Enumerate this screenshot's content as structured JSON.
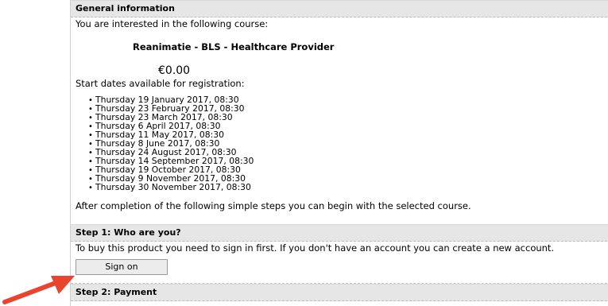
{
  "general": {
    "header": "General information",
    "intro": "You are interested in the following course:",
    "course_name": "Reanimatie - BLS - Healthcare Provider",
    "price": "€0.00",
    "dates_label": "Start dates available for registration:",
    "dates": [
      "Thursday 19 January 2017, 08:30",
      "Thursday 23 February 2017, 08:30",
      "Thursday 23 March 2017, 08:30",
      "Thursday 6 April 2017, 08:30",
      "Thursday 11 May 2017, 08:30",
      "Thursday 8 June 2017, 08:30",
      "Thursday 24 August 2017, 08:30",
      "Thursday 14 September 2017, 08:30",
      "Thursday 19 October 2017, 08:30",
      "Thursday 9 November 2017, 08:30",
      "Thursday 30 November 2017, 08:30"
    ],
    "completion_text": "After completion of the following simple steps you can begin with the selected course."
  },
  "step1": {
    "header": "Step 1: Who are you?",
    "text": "To buy this product you need to sign in first. If you don't have an account you can create a new account.",
    "button_label": "Sign on"
  },
  "step2": {
    "header": "Step 2: Payment"
  },
  "annotation": {
    "arrow_color": "#e8442e"
  }
}
